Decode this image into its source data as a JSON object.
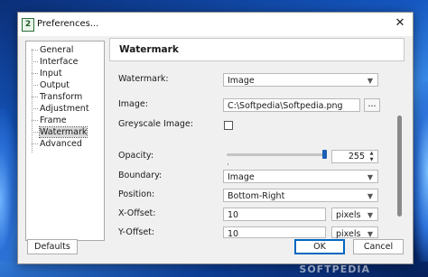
{
  "window": {
    "title": "Preferences...",
    "icon_glyph": "2"
  },
  "nav": {
    "items": [
      {
        "label": "General"
      },
      {
        "label": "Interface"
      },
      {
        "label": "Input"
      },
      {
        "label": "Output"
      },
      {
        "label": "Transform"
      },
      {
        "label": "Adjustment"
      },
      {
        "label": "Frame"
      },
      {
        "label": "Watermark"
      },
      {
        "label": "Advanced"
      }
    ],
    "selected": "Watermark"
  },
  "panel": {
    "title": "Watermark",
    "watermark": {
      "label": "Watermark:",
      "value": "Image"
    },
    "image": {
      "label": "Image:",
      "value": "C:\\Softpedia\\Softpedia.png",
      "browse_label": "..."
    },
    "greyscale": {
      "label": "Greyscale Image:",
      "checked": false
    },
    "opacity": {
      "label": "Opacity:",
      "value": "255",
      "slider_fraction": 0.99
    },
    "boundary": {
      "label": "Boundary:",
      "value": "Image"
    },
    "position": {
      "label": "Position:",
      "value": "Bottom-Right"
    },
    "x_offset": {
      "label": "X-Offset:",
      "value": "10",
      "unit": "pixels"
    },
    "y_offset": {
      "label": "Y-Offset:",
      "value": "10",
      "unit": "pixels"
    }
  },
  "buttons": {
    "defaults": "Defaults",
    "ok": "OK",
    "cancel": "Cancel"
  },
  "overlay": {
    "text": "SOFTPEDIA"
  },
  "colors": {
    "accent": "#0067c0",
    "slider_thumb": "#1a5fb4"
  }
}
